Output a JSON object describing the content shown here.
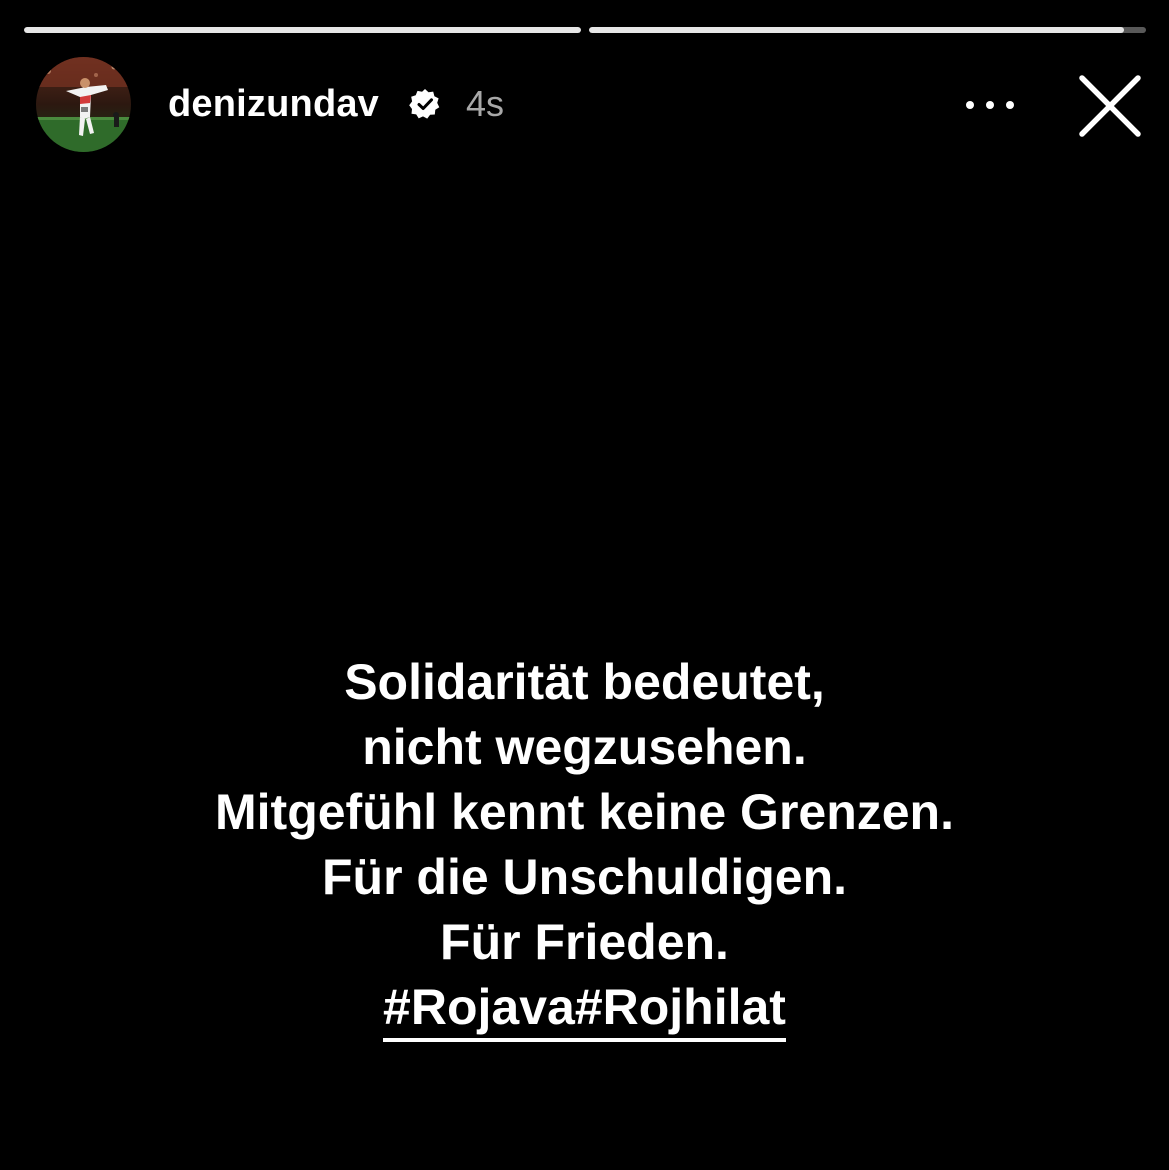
{
  "story": {
    "progress": [
      1.0,
      0.96
    ],
    "account": {
      "username": "denizundav",
      "verified": true,
      "time_ago": "4s",
      "avatar_icon": "profile-photo"
    },
    "header_actions": {
      "more_icon": "more-horizontal-icon",
      "close_icon": "close-icon"
    },
    "lines": [
      "Solidarität bedeutet,",
      "nicht wegzusehen.",
      "Mitgefühl kennt keine Grenzen.",
      "Für die Unschuldigen.",
      "Für Frieden."
    ],
    "hashtags": [
      "#Rojava",
      "#Rojhilat"
    ]
  },
  "colors": {
    "background": "#000000",
    "text": "#ffffff",
    "timestamp": "#a8a8a8",
    "progress_track": "rgba(255,255,255,0.35)",
    "progress_fill": "#e6e6e6"
  }
}
